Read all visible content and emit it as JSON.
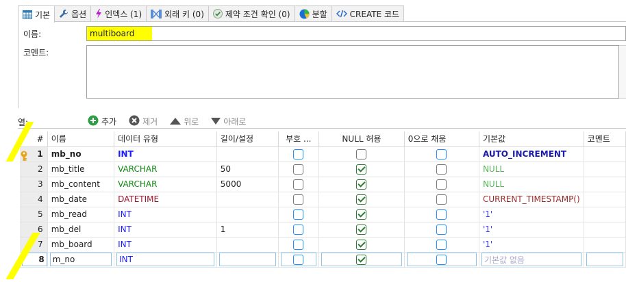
{
  "tabs": [
    {
      "label": "기본",
      "icon": "table-icon",
      "active": true
    },
    {
      "label": "옵션",
      "icon": "wrench-icon"
    },
    {
      "label": "인덱스 (1)",
      "icon": "lightning-icon"
    },
    {
      "label": "외래 키 (0)",
      "icon": "foreign-key-icon"
    },
    {
      "label": "제약 조건 확인 (0)",
      "icon": "check-circle-icon"
    },
    {
      "label": "분할",
      "icon": "pie-icon"
    },
    {
      "label": "CREATE 코드",
      "icon": "code-icon"
    }
  ],
  "form": {
    "name_label": "이름:",
    "name_value": "multiboard",
    "comment_label": "코멘트:",
    "comment_value": ""
  },
  "columns_section": {
    "label": "열:",
    "toolbar": [
      {
        "label": "추가",
        "icon": "plus-circle-icon",
        "enabled": true
      },
      {
        "label": "제거",
        "icon": "x-circle-icon",
        "enabled": false
      },
      {
        "label": "위로",
        "icon": "up-arrow-icon",
        "enabled": false
      },
      {
        "label": "아래로",
        "icon": "down-arrow-icon",
        "enabled": false
      }
    ]
  },
  "grid": {
    "headers": [
      "#",
      "이름",
      "데이터 유형",
      "길이/설정",
      "부호 ...",
      "NULL 허용",
      "0으로 채움",
      "기본값",
      "코멘트"
    ],
    "rows": [
      {
        "num": "1",
        "name": "mb_no",
        "type": "INT",
        "length": "",
        "unsigned": false,
        "nullable": false,
        "zerofill": false,
        "default": "AUTO_INCREMENT",
        "comment": ""
      },
      {
        "num": "2",
        "name": "mb_title",
        "type": "VARCHAR",
        "length": "50",
        "unsigned": false,
        "nullable": true,
        "zerofill": false,
        "default": "NULL",
        "comment": ""
      },
      {
        "num": "3",
        "name": "mb_content",
        "type": "VARCHAR",
        "length": "5000",
        "unsigned": false,
        "nullable": true,
        "zerofill": false,
        "default": "NULL",
        "comment": ""
      },
      {
        "num": "4",
        "name": "mb_date",
        "type": "DATETIME",
        "length": "",
        "unsigned": false,
        "nullable": true,
        "zerofill": false,
        "default": "CURRENT_TIMESTAMP()",
        "comment": ""
      },
      {
        "num": "5",
        "name": "mb_read",
        "type": "INT",
        "length": "",
        "unsigned": false,
        "nullable": true,
        "zerofill": false,
        "default": "'1'",
        "comment": ""
      },
      {
        "num": "6",
        "name": "mb_del",
        "type": "INT",
        "length": "1",
        "unsigned": false,
        "nullable": true,
        "zerofill": false,
        "default": "'1'",
        "comment": ""
      },
      {
        "num": "7",
        "name": "mb_board",
        "type": "INT",
        "length": "",
        "unsigned": false,
        "nullable": true,
        "zerofill": false,
        "default": "'1'",
        "comment": ""
      },
      {
        "num": "8",
        "name": "m_no",
        "type": "INT",
        "length": "",
        "unsigned": false,
        "nullable": true,
        "zerofill": false,
        "default_placeholder": "기본값 없음",
        "comment": ""
      }
    ]
  },
  "colors": {
    "highlight": "#ffff00",
    "type_int": "#1a1aff",
    "type_varchar": "#118a11",
    "type_datetime": "#a3122d",
    "default_null": "#59b359",
    "checkbox_blue": "#1e90ff",
    "checkbox_checked": "#2e7d32"
  }
}
